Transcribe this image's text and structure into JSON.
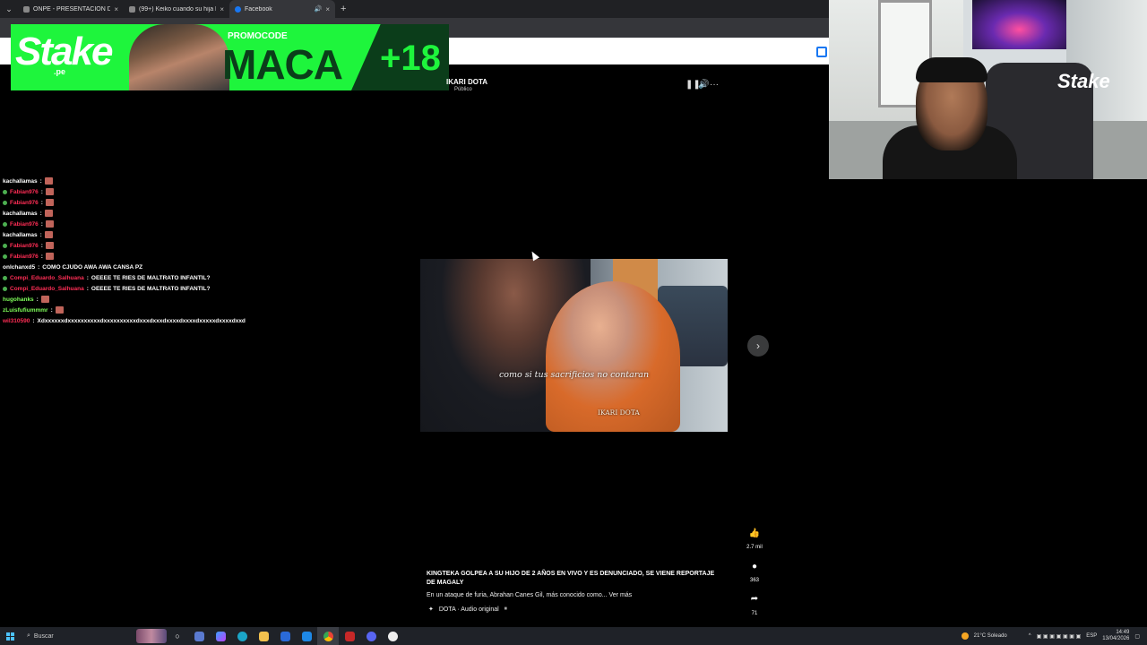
{
  "browser": {
    "tabs": [
      {
        "title": "ONPE - PRESENTACIÓN DE RES",
        "active": false
      },
      {
        "title": "(99+) Keiko cuando su hija Kiara",
        "active": false
      },
      {
        "title": "Facebook",
        "active": true
      }
    ],
    "new_tab": "+",
    "close": "×"
  },
  "banner": {
    "brand": "Stake",
    "brand_domain": ".pe",
    "promo_label": "PROMOCODE",
    "promo_code": "MACA",
    "age": "+18"
  },
  "post": {
    "author": "IKARI DOTA",
    "privacy": "Público",
    "title": "KINGTEKA GOLPEA A SU HIJO DE 2 AÑOS EN VIVO Y ES DENUNCIADO, SE VIENE REPORTAJE DE MAGALY",
    "description": "En un ataque de furia, Abrahan Canes Gil, más conocido como... Ver más",
    "audio": "DOTA · Audio original",
    "video_caption": "como si tus sacrificios no contaran",
    "video_watermark": "IKARI DOTA",
    "reactions": {
      "likes": "2.7 mil",
      "comments": "363",
      "shares": "71"
    }
  },
  "chat": [
    {
      "user": "kachallamas",
      "text": "",
      "color": "#ffffff",
      "badge": false,
      "emote": true
    },
    {
      "user": "Fabian976",
      "text": "",
      "color": "#ff2d55",
      "badge": true,
      "emote": true
    },
    {
      "user": "Fabian976",
      "text": "",
      "color": "#ff2d55",
      "badge": true,
      "emote": true
    },
    {
      "user": "kachallamas",
      "text": "",
      "color": "#ffffff",
      "badge": false,
      "emote": true
    },
    {
      "user": "Fabian976",
      "text": "",
      "color": "#ff2d55",
      "badge": true,
      "emote": true
    },
    {
      "user": "kachallamas",
      "text": "",
      "color": "#ffffff",
      "badge": false,
      "emote": true
    },
    {
      "user": "Fabian976",
      "text": "",
      "color": "#ff2d55",
      "badge": true,
      "emote": true
    },
    {
      "user": "Fabian976",
      "text": "",
      "color": "#ff2d55",
      "badge": true,
      "emote": true
    },
    {
      "user": "onlchanxd5",
      "text": "COMO CJUDO AWA AWA CANSA PZ",
      "color": "#ffffff",
      "badge": false,
      "emote": false
    },
    {
      "user": "Compi_Eduardo_Salhuana",
      "text": "OEEEE TE RIES DE MALTRATO INFANTIL?",
      "color": "#ff2d55",
      "badge": true,
      "emote": false
    },
    {
      "user": "Compi_Eduardo_Salhuana",
      "text": "OEEEE TE RIES DE MALTRATO INFANTIL?",
      "color": "#ff2d55",
      "badge": true,
      "emote": false
    },
    {
      "user": "hugohanks",
      "text": "",
      "color": "#7fff5a",
      "badge": false,
      "emote": true
    },
    {
      "user": "zLuisfufiummmr",
      "text": "",
      "color": "#7fff5a",
      "badge": false,
      "emote": true
    },
    {
      "user": "wil310590",
      "text": "Xdxxxxxxdxxxxxxxxxxdxxxxxxxxxxdxxxdxxxdxxxxdxxxxdxxxxxdxxxxdxxd",
      "color": "#ff2d55",
      "badge": false,
      "emote": false
    }
  ],
  "webcam": {
    "logo": "Stake"
  },
  "taskbar": {
    "search_placeholder": "Buscar",
    "weather": "21°C Soleado",
    "lang": "ESP",
    "time": "14:49",
    "date": "13/04/2026"
  }
}
